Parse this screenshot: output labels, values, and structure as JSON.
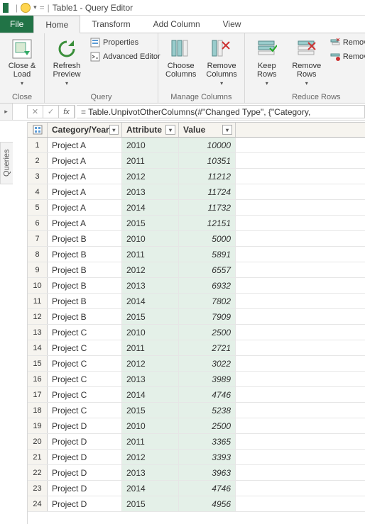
{
  "title": "Table1 - Query Editor",
  "tabs": {
    "file": "File",
    "home": "Home",
    "transform": "Transform",
    "add_column": "Add Column",
    "view": "View"
  },
  "ribbon": {
    "close": {
      "label": "Close &\nLoad",
      "group": "Close"
    },
    "query": {
      "refresh": "Refresh\nPreview",
      "properties": "Properties",
      "adv_editor": "Advanced Editor",
      "group": "Query"
    },
    "manage_cols": {
      "choose": "Choose\nColumns",
      "remove": "Remove\nColumns",
      "group": "Manage Columns"
    },
    "reduce_rows": {
      "keep": "Keep\nRows",
      "remove": "Remove\nRows",
      "removeD": "Remove D",
      "removeE": "Remove Er",
      "group": "Reduce Rows"
    }
  },
  "formula": "= Table.UnpivotOtherColumns(#\"Changed Type\", {\"Category,",
  "queries_label": "Queries",
  "columns": {
    "cat": "Category/Year",
    "attr": "Attribute",
    "val": "Value"
  },
  "rows": [
    {
      "n": 1,
      "cat": "Project A",
      "attr": "2010",
      "val": "10000"
    },
    {
      "n": 2,
      "cat": "Project A",
      "attr": "2011",
      "val": "10351"
    },
    {
      "n": 3,
      "cat": "Project A",
      "attr": "2012",
      "val": "11212"
    },
    {
      "n": 4,
      "cat": "Project A",
      "attr": "2013",
      "val": "11724"
    },
    {
      "n": 5,
      "cat": "Project A",
      "attr": "2014",
      "val": "11732"
    },
    {
      "n": 6,
      "cat": "Project A",
      "attr": "2015",
      "val": "12151"
    },
    {
      "n": 7,
      "cat": "Project B",
      "attr": "2010",
      "val": "5000"
    },
    {
      "n": 8,
      "cat": "Project B",
      "attr": "2011",
      "val": "5891"
    },
    {
      "n": 9,
      "cat": "Project B",
      "attr": "2012",
      "val": "6557"
    },
    {
      "n": 10,
      "cat": "Project B",
      "attr": "2013",
      "val": "6932"
    },
    {
      "n": 11,
      "cat": "Project B",
      "attr": "2014",
      "val": "7802"
    },
    {
      "n": 12,
      "cat": "Project B",
      "attr": "2015",
      "val": "7909"
    },
    {
      "n": 13,
      "cat": "Project C",
      "attr": "2010",
      "val": "2500"
    },
    {
      "n": 14,
      "cat": "Project C",
      "attr": "2011",
      "val": "2721"
    },
    {
      "n": 15,
      "cat": "Project C",
      "attr": "2012",
      "val": "3022"
    },
    {
      "n": 16,
      "cat": "Project C",
      "attr": "2013",
      "val": "3989"
    },
    {
      "n": 17,
      "cat": "Project C",
      "attr": "2014",
      "val": "4746"
    },
    {
      "n": 18,
      "cat": "Project C",
      "attr": "2015",
      "val": "5238"
    },
    {
      "n": 19,
      "cat": "Project D",
      "attr": "2010",
      "val": "2500"
    },
    {
      "n": 20,
      "cat": "Project D",
      "attr": "2011",
      "val": "3365"
    },
    {
      "n": 21,
      "cat": "Project D",
      "attr": "2012",
      "val": "3393"
    },
    {
      "n": 22,
      "cat": "Project D",
      "attr": "2013",
      "val": "3963"
    },
    {
      "n": 23,
      "cat": "Project D",
      "attr": "2014",
      "val": "4746"
    },
    {
      "n": 24,
      "cat": "Project D",
      "attr": "2015",
      "val": "4956"
    }
  ]
}
